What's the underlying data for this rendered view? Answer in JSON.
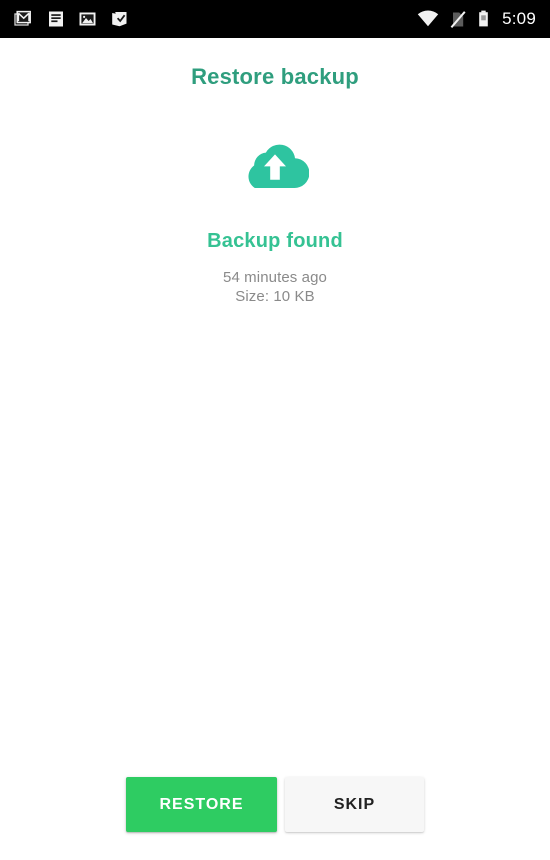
{
  "status_bar": {
    "notification_icons": [
      {
        "name": "gmail-icon",
        "label": "Gmail"
      },
      {
        "name": "document-icon",
        "label": "Document"
      },
      {
        "name": "photo-icon",
        "label": "Photo"
      },
      {
        "name": "checkmark-icon",
        "label": "Tasks"
      }
    ],
    "system_icons": [
      {
        "name": "wifi-icon",
        "label": "Wi-Fi"
      },
      {
        "name": "no-sim-icon",
        "label": "No SIM"
      },
      {
        "name": "battery-icon",
        "label": "Battery"
      }
    ],
    "time": "5:09"
  },
  "screen": {
    "title": "Restore backup",
    "icon": "cloud-upload-icon",
    "status_label": "Backup found",
    "meta": [
      "54 minutes ago",
      "Size: 10 KB"
    ]
  },
  "actions": {
    "restore_label": "RESTORE",
    "skip_label": "SKIP"
  },
  "colors": {
    "title_green": "#2f9e7e",
    "status_green": "#35c293",
    "cloud_teal": "#2ec4a0",
    "restore_green": "#2ecc62",
    "skip_bg": "#f7f7f7",
    "meta_grey": "#8a8a8a",
    "status_bar_bg": "#000000",
    "page_bg": "#ffffff"
  }
}
